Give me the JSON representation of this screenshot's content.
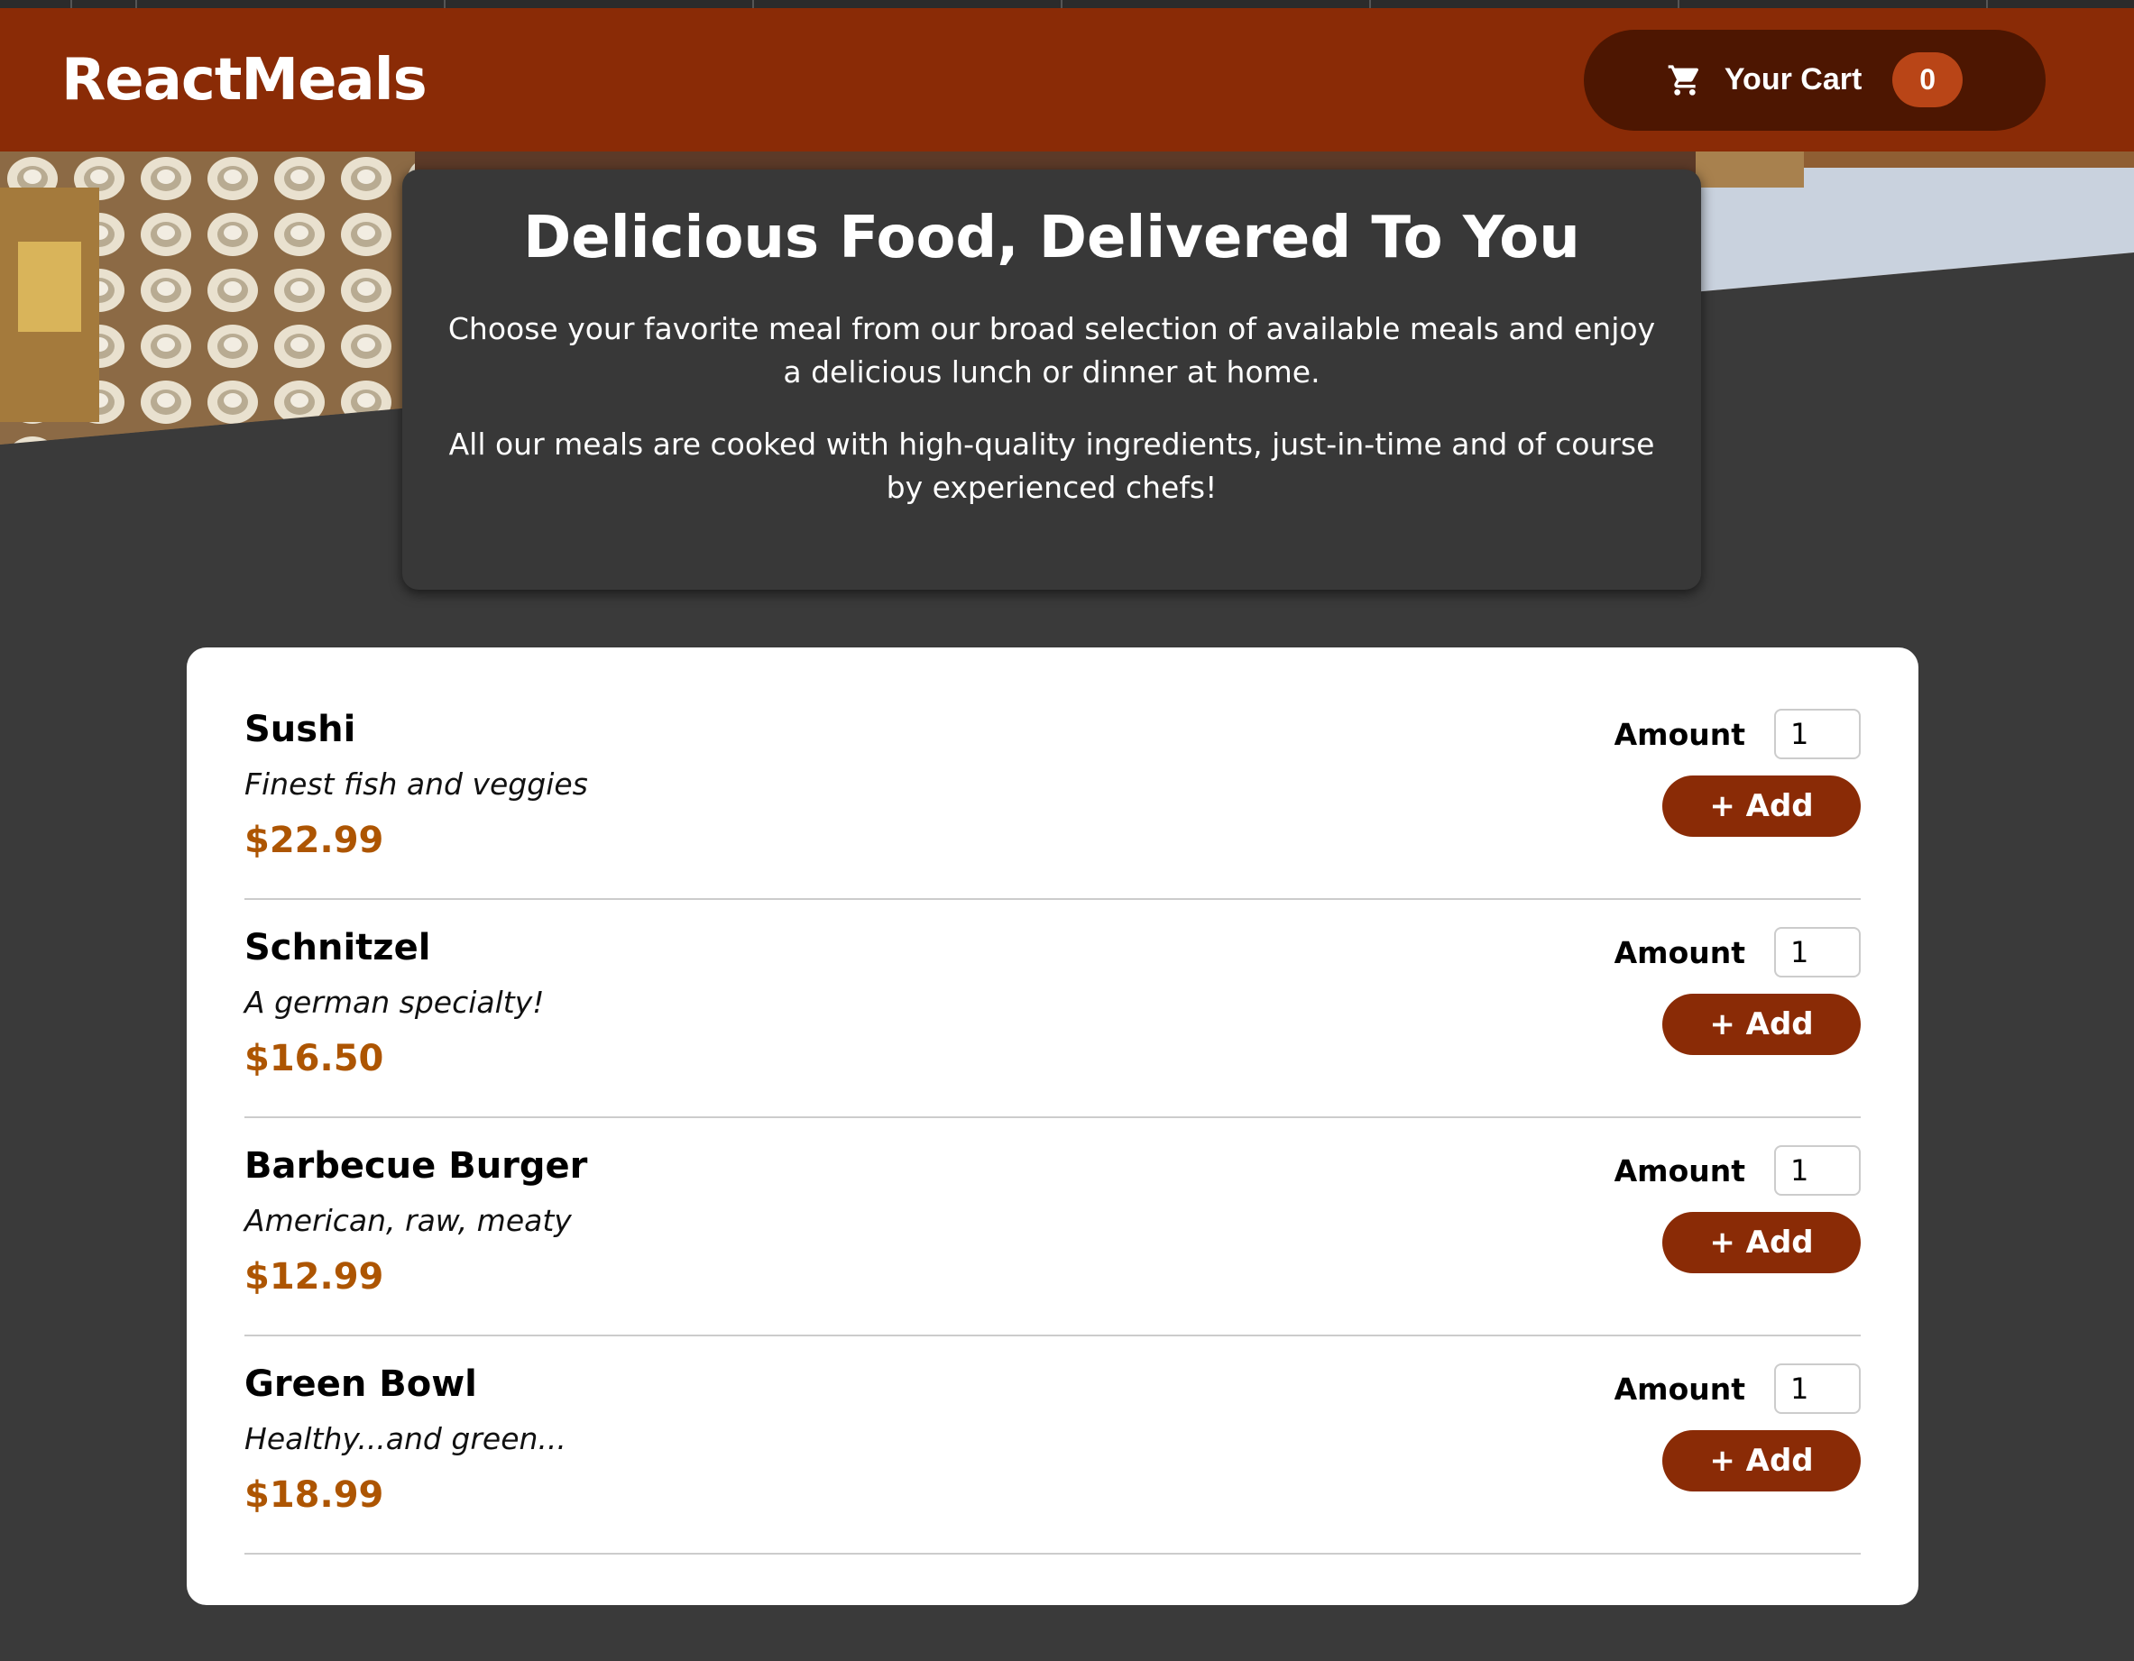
{
  "header": {
    "logo": "ReactMeals",
    "cart_label": "Your Cart",
    "cart_count": "0"
  },
  "summary": {
    "title": "Delicious Food, Delivered To You",
    "paragraph1": "Choose your favorite meal from our broad selection of available meals and enjoy a delicious lunch or dinner at home.",
    "paragraph2": "All our meals are cooked with high-quality ingredients, just-in-time and of course by experienced chefs!"
  },
  "meals": [
    {
      "name": "Sushi",
      "description": "Finest fish and veggies",
      "price": "$22.99",
      "amount_label": "Amount",
      "amount_value": "1",
      "add_label": "+ Add"
    },
    {
      "name": "Schnitzel",
      "description": "A german specialty!",
      "price": "$16.50",
      "amount_label": "Amount",
      "amount_value": "1",
      "add_label": "+ Add"
    },
    {
      "name": "Barbecue Burger",
      "description": "American, raw, meaty",
      "price": "$12.99",
      "amount_label": "Amount",
      "amount_value": "1",
      "add_label": "+ Add"
    },
    {
      "name": "Green Bowl",
      "description": "Healthy...and green...",
      "price": "$18.99",
      "amount_label": "Amount",
      "amount_value": "1",
      "add_label": "+ Add"
    }
  ],
  "icons": {
    "cart": "cart-icon"
  },
  "colors": {
    "header_bg": "#8a2b06",
    "cart_button_bg": "#4d1601",
    "badge_bg": "#b94517",
    "price": "#ad5502",
    "page_bg": "#383838"
  }
}
